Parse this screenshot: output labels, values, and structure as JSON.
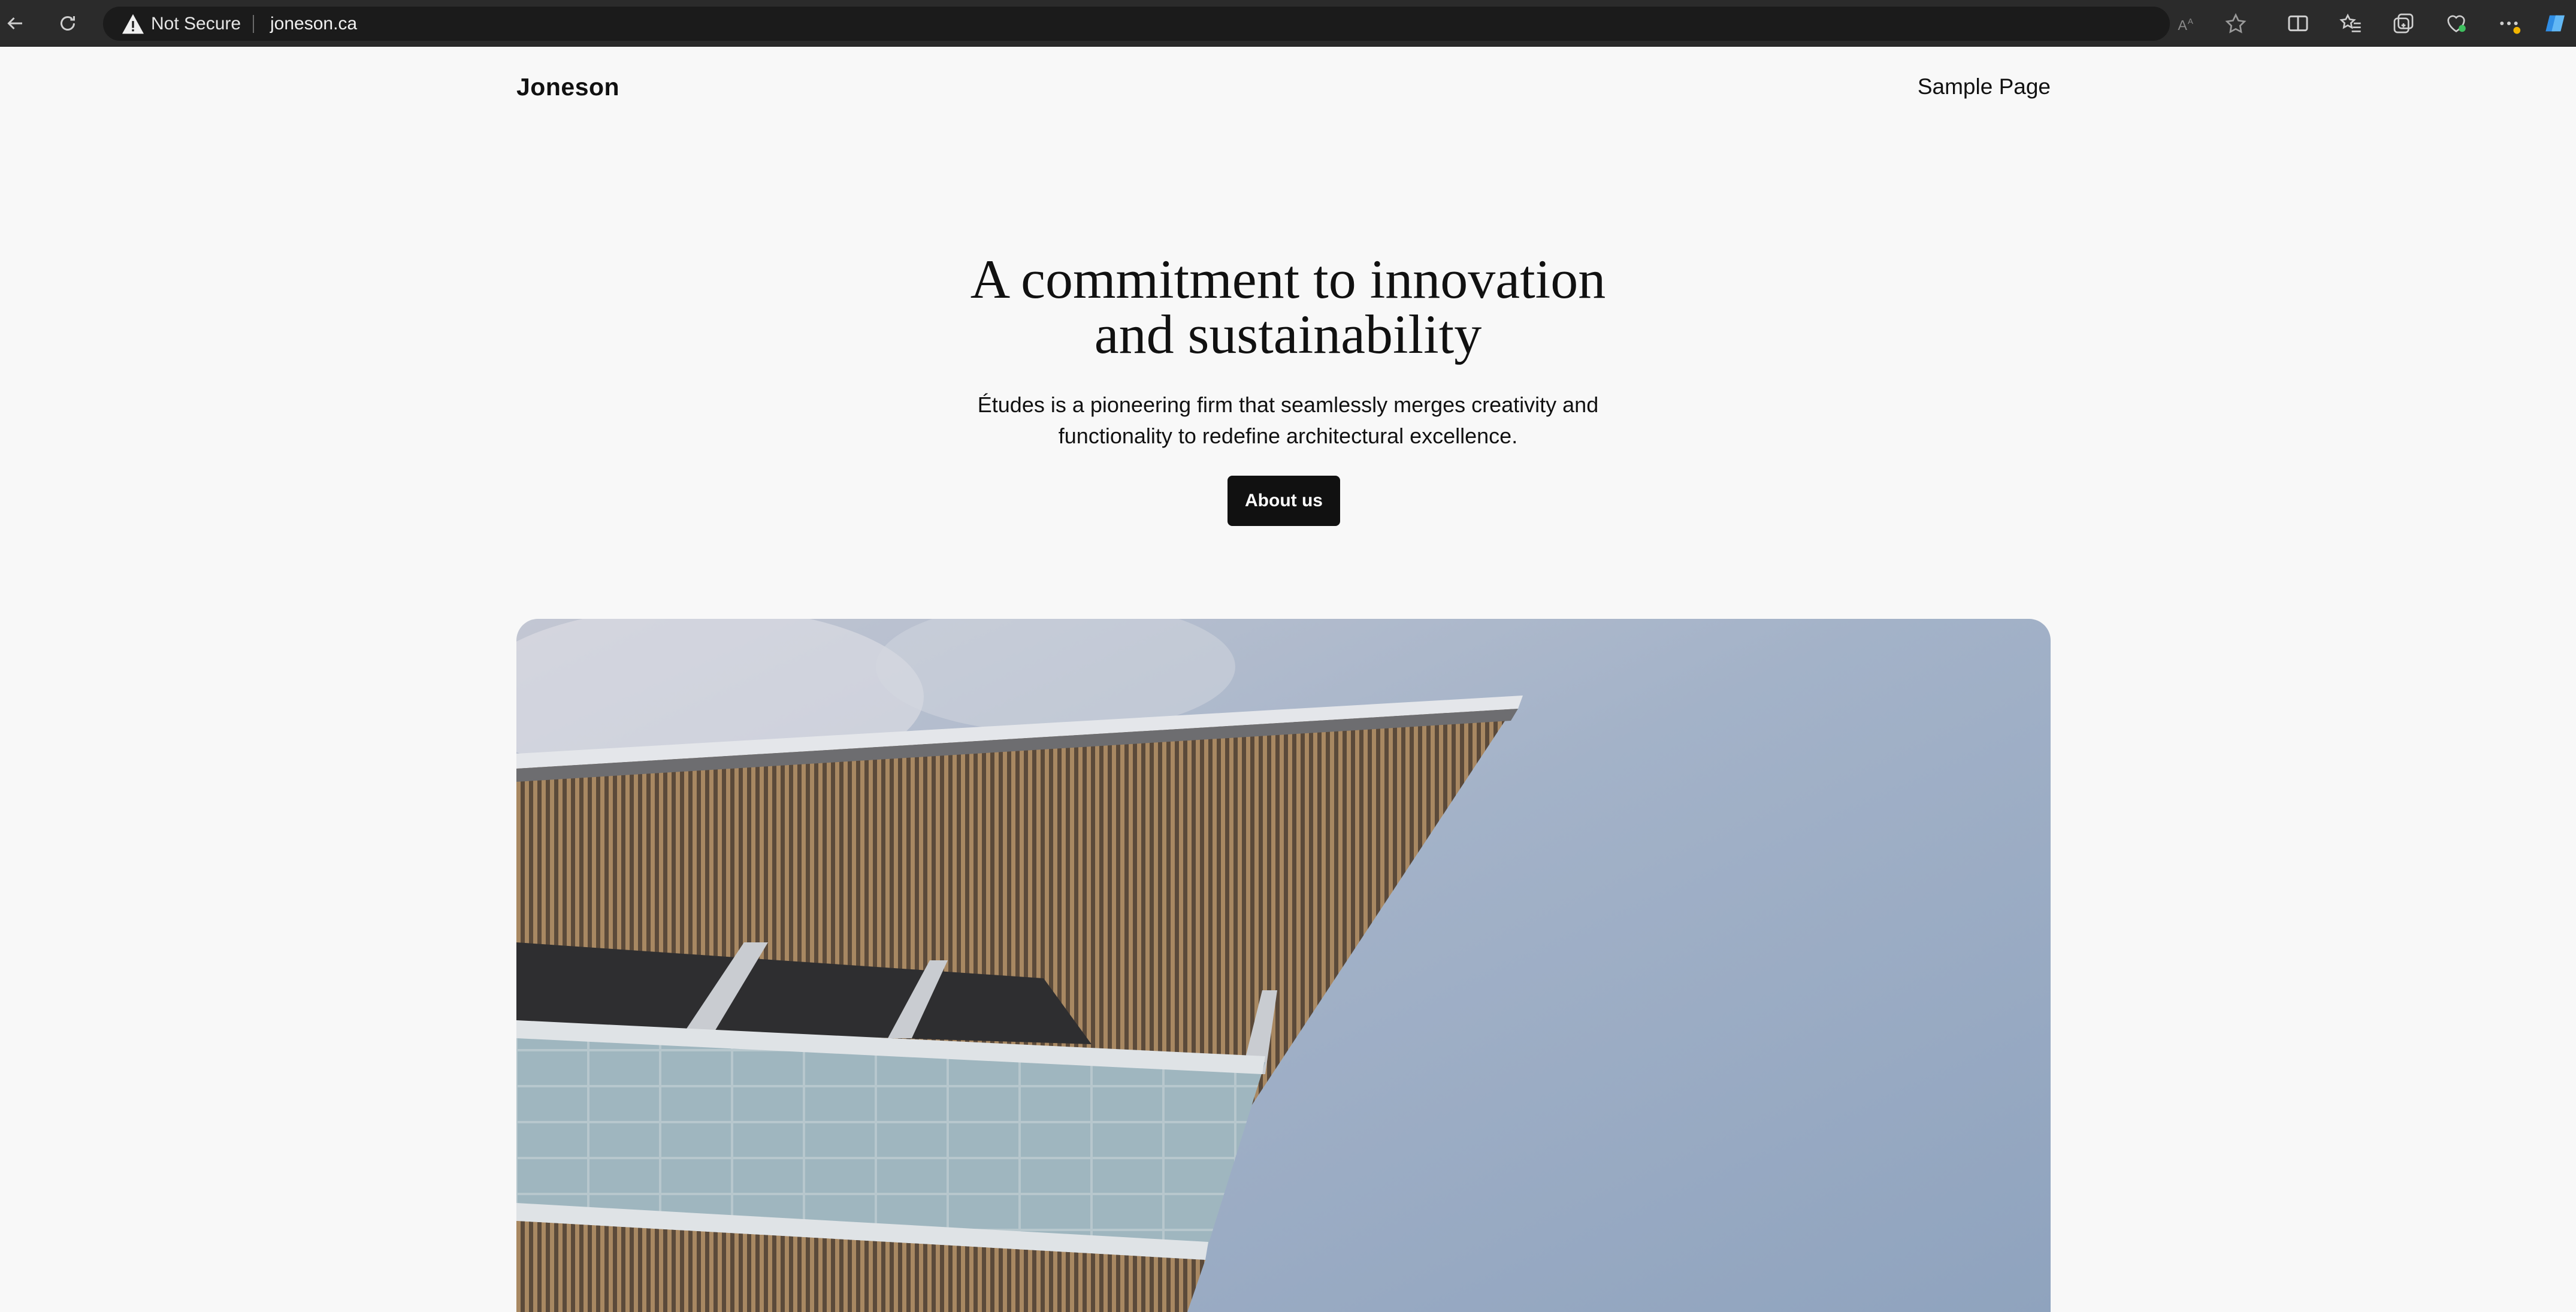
{
  "browser": {
    "security_label": "Not Secure",
    "url": "joneson.ca",
    "icons": [
      "back-arrow-icon",
      "reload-icon",
      "warning-icon",
      "read-aloud-icon",
      "favorite-star-icon",
      "split-screen-icon",
      "favorites-icon",
      "collections-icon",
      "browser-essentials-icon",
      "more-icon",
      "copilot-icon"
    ]
  },
  "header": {
    "site_title": "Joneson",
    "nav_link": "Sample Page"
  },
  "hero": {
    "heading_line1": "A commitment to innovation",
    "heading_line2": "and sustainability",
    "text_line1": "Études is a pioneering firm that seamlessly merges creativity and",
    "text_line2": "functionality to redefine architectural excellence.",
    "button_label": "About us"
  },
  "colors": {
    "page_bg": "#f8f8f8",
    "button_bg": "#111111",
    "chrome_bg": "#2b2b2b"
  }
}
